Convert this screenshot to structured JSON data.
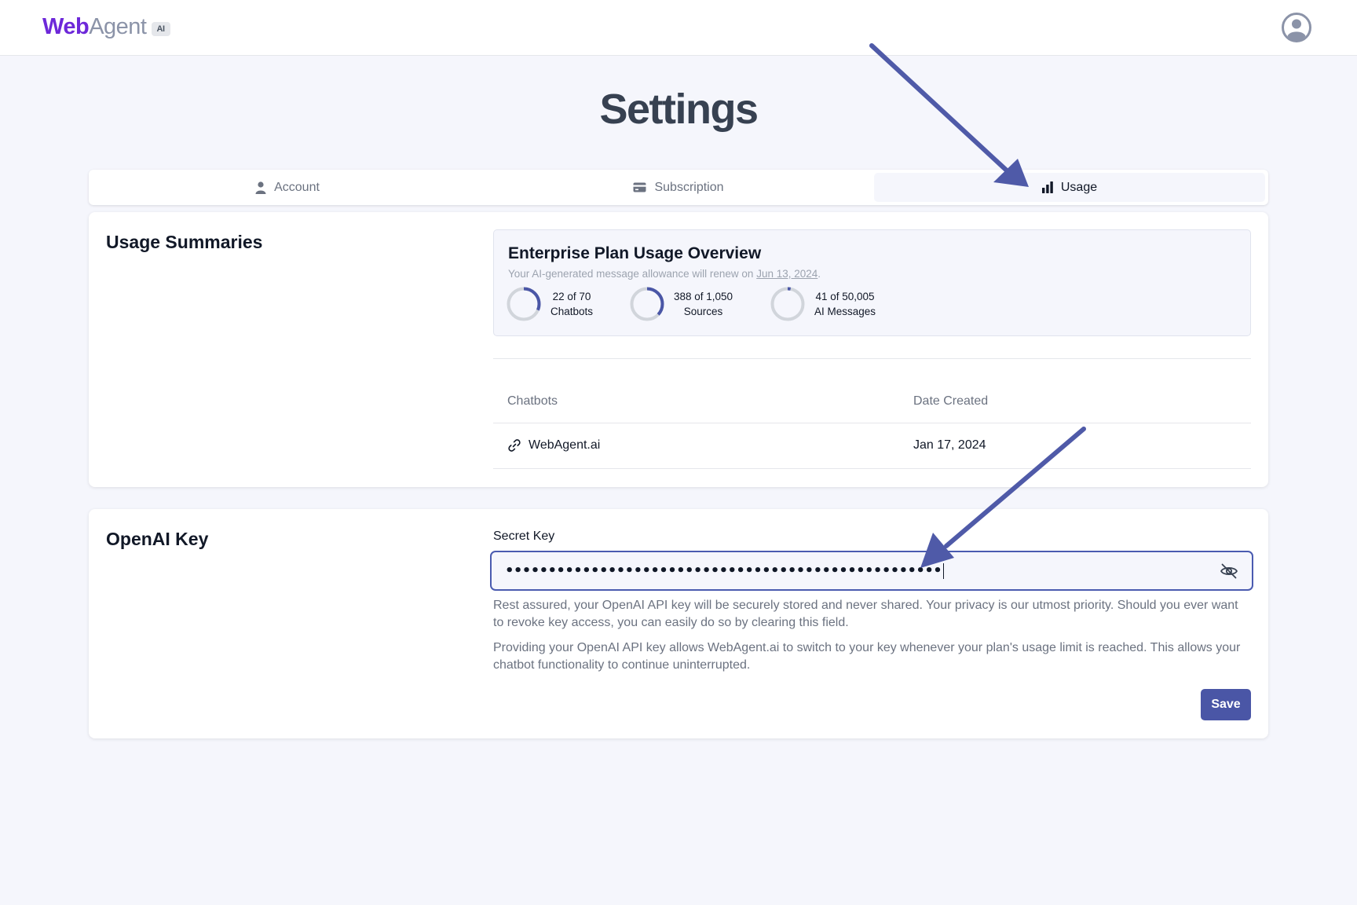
{
  "header": {
    "logo_web": "Web",
    "logo_agent": "Agent",
    "logo_badge": "AI",
    "avatar_icon": "user-circle-icon"
  },
  "page": {
    "title": "Settings"
  },
  "tabs": [
    {
      "label": "Account",
      "icon": "user-icon",
      "active": false
    },
    {
      "label": "Subscription",
      "icon": "credit-card-icon",
      "active": false
    },
    {
      "label": "Usage",
      "icon": "bar-chart-icon",
      "active": true
    }
  ],
  "usage": {
    "title": "Usage Summaries",
    "overview": {
      "title": "Enterprise Plan Usage Overview",
      "subtitle_prefix": "Your AI-generated message allowance will renew on",
      "renew_date": "Jun 13, 2024",
      "subtitle_suffix": ".",
      "stats": [
        {
          "line1": "22 of 70",
          "line2": "Chatbots",
          "used": 22,
          "total": 70
        },
        {
          "line1": "388 of 1,050",
          "line2": "Sources",
          "used": 388,
          "total": 1050
        },
        {
          "line1": "41 of 50,005",
          "line2": "AI Messages",
          "used": 41,
          "total": 50005
        }
      ]
    },
    "table": {
      "headers": [
        "Chatbots",
        "Date Created"
      ],
      "rows": [
        {
          "name": "WebAgent.ai",
          "icon": "link-icon",
          "date": "Jan 17, 2024"
        }
      ]
    }
  },
  "openai": {
    "title": "OpenAI Key",
    "field_label": "Secret Key",
    "masked_value": "•••••••••••••••••••••••••••••••••••••••••••••••••••",
    "toggle_icon": "eye-off-icon",
    "help1": "Rest assured, your OpenAI API key will be securely stored and never shared. Your privacy is our utmost priority. Should you ever want to revoke key access, you can easily do so by clearing this field.",
    "help2": "Providing your OpenAI API key allows WebAgent.ai to switch to your key whenever your plan's usage limit is reached. This allows your chatbot functionality to continue uninterrupted.",
    "save_label": "Save"
  },
  "colors": {
    "brand": "#6d28d9",
    "accent": "#4a56a6",
    "annotation_arrow": "#4f5aa8",
    "ring_track": "#d1d5db",
    "ring_fill": "#4a56a6"
  }
}
